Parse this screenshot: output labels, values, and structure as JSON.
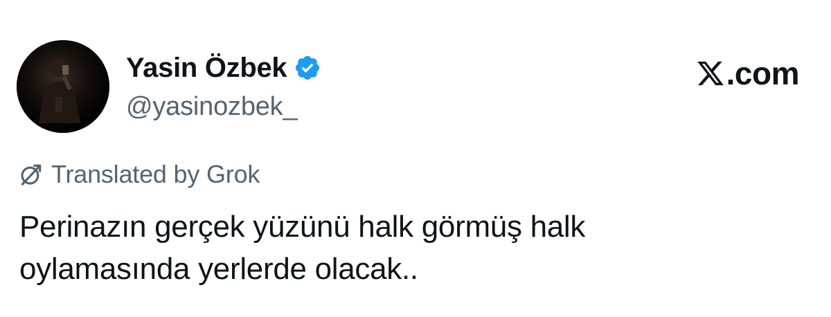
{
  "author": {
    "display_name": "Yasin Özbek",
    "handle": "@yasinozbek_",
    "verified": true,
    "avatar_icon": "profile-photo-dark",
    "verified_icon": "verified-badge-icon",
    "verified_color": "#1d9bf0"
  },
  "brand": {
    "icon": "x-logo-icon",
    "suffix": ".com"
  },
  "translation": {
    "icon": "grok-icon",
    "label": "Translated by Grok"
  },
  "tweet": {
    "lines": [
      "Perinazın gerçek yüzünü halk görmüş halk",
      "oylamasında yerlerde olacak.."
    ]
  },
  "colors": {
    "text_primary": "#0f1419",
    "text_secondary": "#536471",
    "background": "#ffffff"
  }
}
